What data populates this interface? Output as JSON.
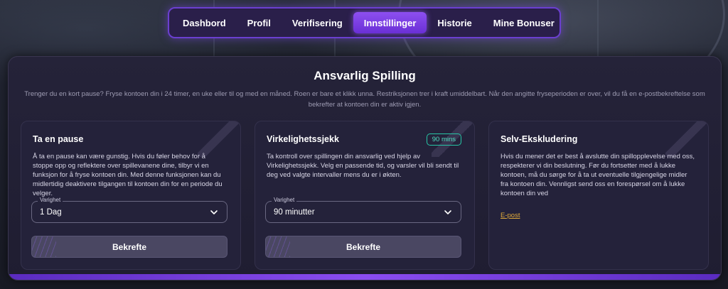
{
  "tabs": [
    {
      "label": "Dashbord"
    },
    {
      "label": "Profil"
    },
    {
      "label": "Verifisering"
    },
    {
      "label": "Innstillinger",
      "active": true
    },
    {
      "label": "Historie"
    },
    {
      "label": "Mine Bonuser"
    }
  ],
  "panel": {
    "title": "Ansvarlig Spilling",
    "description": "Trenger du en kort pause? Fryse kontoen din i 24 timer, en uke eller til og med en måned. Roen er bare et klikk unna. Restriksjonen trer i kraft umiddelbart. Når den angitte fryseperioden er over, vil du få en e-postbekreftelse som bekrefter at kontoen din er aktiv igjen."
  },
  "cards": {
    "pause": {
      "title": "Ta en pause",
      "text": "Å ta en pause kan være gunstig. Hvis du føler behov for å stoppe opp og reflektere over spillevanene dine, tilbyr vi en funksjon for å fryse kontoen din. Med denne funksjonen kan du midlertidig deaktivere tilgangen til kontoen din for en periode du velger.",
      "select_label": "Varighet",
      "select_value": "1 Dag",
      "button": "Bekrefte"
    },
    "reality": {
      "title": "Virkelighetssjekk",
      "badge": "90 mins",
      "text": "Ta kontroll over spillingen din ansvarlig ved hjelp av Virkelighetssjekk. Velg en passende tid, og varsler vil bli sendt til deg ved valgte intervaller mens du er i økten.",
      "select_label": "Varighet",
      "select_value": "90 minutter",
      "button": "Bekrefte"
    },
    "exclusion": {
      "title": "Selv-Ekskludering",
      "text": "Hvis du mener det er best å avslutte din spillopplevelse med oss, respekterer vi din beslutning. Før du fortsetter med å lukke kontoen, må du sørge for å ta ut eventuelle tilgjengelige midler fra kontoen din. Vennligst send oss en forespørsel om å lukke kontoen din ved",
      "link": "E-post"
    }
  },
  "colors": {
    "accent": "#7a3fe6",
    "badge": "#27c6a6",
    "link": "#e0a93a"
  }
}
